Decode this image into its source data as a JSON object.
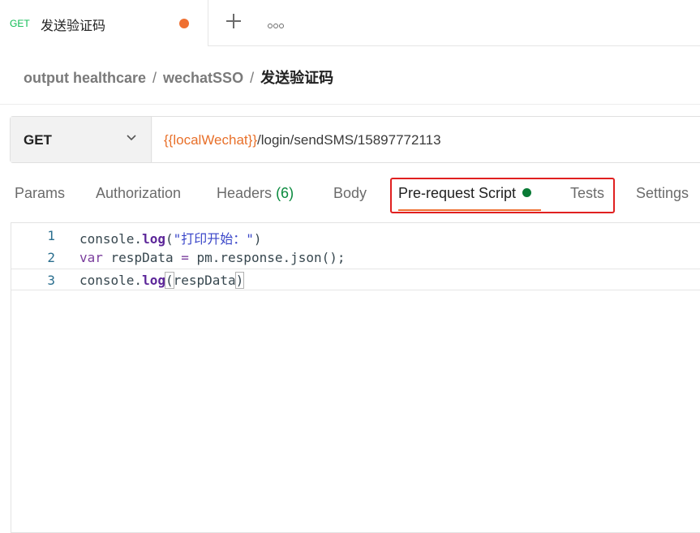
{
  "tab": {
    "method": "GET",
    "name": "发送验证码"
  },
  "breadcrumb": {
    "workspace": "output healthcare",
    "collection": "wechatSSO",
    "request": "发送验证码",
    "separator": "/"
  },
  "request": {
    "method": "GET",
    "url_variable": "{{localWechat}}",
    "url_path": "/login/sendSMS/15897772113"
  },
  "request_tabs": [
    {
      "label": "Params"
    },
    {
      "label": "Authorization"
    },
    {
      "label": "Headers",
      "count": "(6)"
    },
    {
      "label": "Body"
    },
    {
      "label": "Pre-request Script",
      "active": true
    },
    {
      "label": "Tests"
    },
    {
      "label": "Settings"
    }
  ],
  "editor": {
    "lines": [
      {
        "num": "1",
        "parts": [
          "console.",
          "log",
          "(",
          "\"打印开始：\"",
          ")"
        ]
      },
      {
        "num": "2",
        "parts": [
          "var",
          " respData ",
          "=",
          " pm.response.json();"
        ]
      },
      {
        "num": "3",
        "parts": [
          "console.",
          "log",
          "(",
          "respData",
          ")"
        ]
      }
    ]
  },
  "colors": {
    "accent": "#ef7032",
    "get_method": "#0cbb52",
    "headers_count": "#0a8a3e",
    "script_dot": "#097a35",
    "highlight": "#e02020"
  }
}
